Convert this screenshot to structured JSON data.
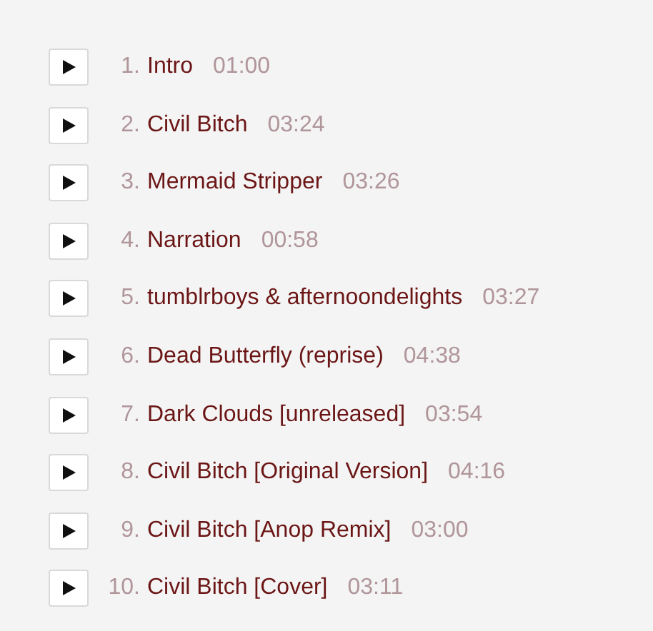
{
  "tracks": [
    {
      "number": "1.",
      "title": "Intro",
      "duration": "01:00"
    },
    {
      "number": "2.",
      "title": "Civil Bitch",
      "duration": "03:24"
    },
    {
      "number": "3.",
      "title": "Mermaid Stripper",
      "duration": "03:26"
    },
    {
      "number": "4.",
      "title": "Narration",
      "duration": "00:58"
    },
    {
      "number": "5.",
      "title": "tumblrboys & afternoondelights",
      "duration": "03:27"
    },
    {
      "number": "6.",
      "title": "Dead Butterfly (reprise)",
      "duration": "04:38"
    },
    {
      "number": "7.",
      "title": "Dark Clouds [unreleased]",
      "duration": "03:54"
    },
    {
      "number": "8.",
      "title": "Civil Bitch [Original Version]",
      "duration": "04:16"
    },
    {
      "number": "9.",
      "title": "Civil Bitch [Anop Remix]",
      "duration": "03:00"
    },
    {
      "number": "10.",
      "title": "Civil Bitch [Cover]",
      "duration": "03:11"
    }
  ]
}
